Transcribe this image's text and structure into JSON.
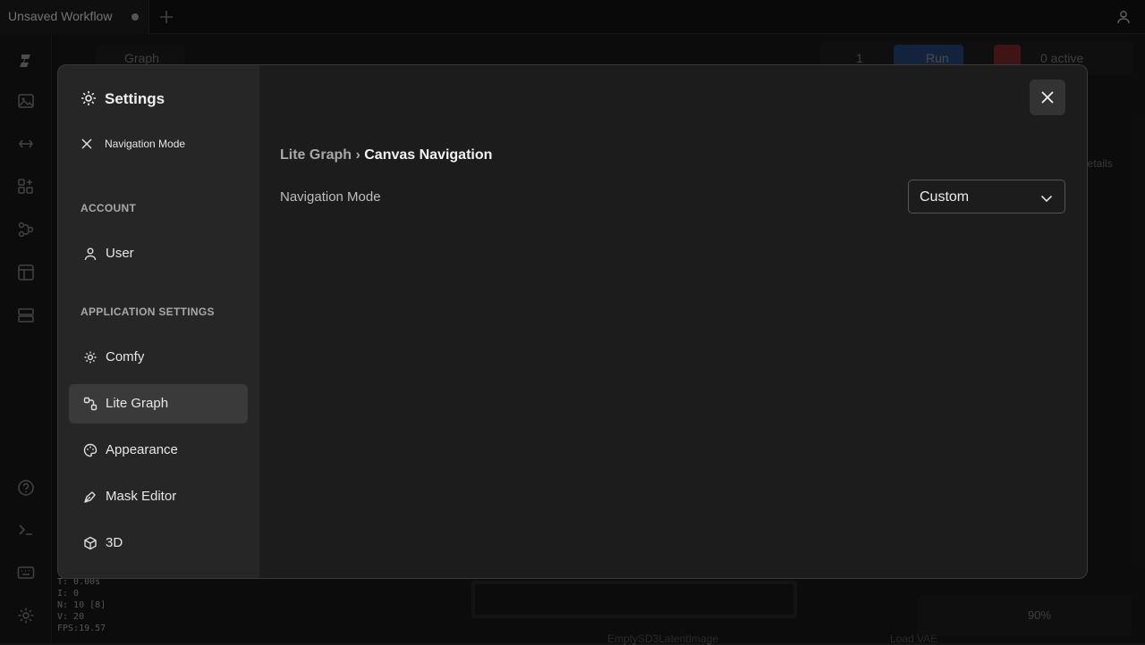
{
  "tab": {
    "title": "Unsaved Workflow"
  },
  "background": {
    "graph_label": "Graph",
    "queue_count": "1",
    "run_label": "Run",
    "active_label": "0 active",
    "details_label": "details",
    "zoom_label": "90%",
    "node_label_empty_latent": "EmptySD3LatentImage",
    "node_label_load": "Load VAE",
    "stats": [
      "T: 0.00s",
      "I: 0",
      "N: 10 [8]",
      "V: 20",
      "FPS:19.57"
    ]
  },
  "settings": {
    "title": "Settings",
    "search_value": "Navigation Mode",
    "sections": {
      "account": "ACCOUNT",
      "application": "APPLICATION SETTINGS"
    },
    "nav": {
      "user": "User",
      "comfy": "Comfy",
      "lite_graph": "Lite Graph",
      "appearance": "Appearance",
      "mask_editor": "Mask Editor",
      "three_d": "3D"
    },
    "breadcrumb": {
      "parent": "Lite Graph",
      "separator": " › ",
      "current": "Canvas Navigation"
    },
    "setting": {
      "label": "Navigation Mode",
      "value": "Custom"
    }
  }
}
